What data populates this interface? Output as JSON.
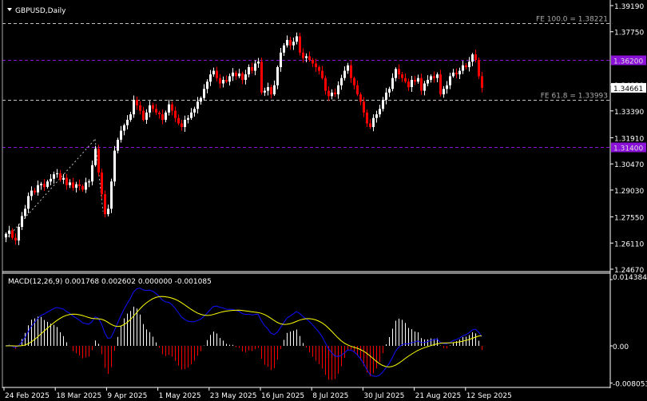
{
  "header": {
    "title": "GBPUSD,Daily",
    "menu_icon": "triangle-down-icon"
  },
  "colors": {
    "bull": "#ffffff",
    "bear": "#ff0000",
    "level": "#8b10d8",
    "fibo": "#c0c0c0",
    "macd": "#1010ff",
    "signal": "#ffff00",
    "background": "#000000"
  },
  "chart_data": [
    {
      "type": "candlestick",
      "symbol": "GBPUSD",
      "timeframe": "Daily",
      "ylim": [
        1.2467,
        1.3919
      ],
      "y_ticks": [
        "1.39190",
        "1.37750",
        "1.34830",
        "1.33390",
        "1.31910",
        "1.30470",
        "1.29030",
        "1.27550",
        "1.26110",
        "1.24670"
      ],
      "x_ticks": [
        "24 Feb 2025",
        "18 Mar 2025",
        "9 Apr 2025",
        "1 May 2025",
        "23 May 2025",
        "16 Jun 2025",
        "8 Jul 2025",
        "30 Jul 2025",
        "21 Aug 2025",
        "12 Sep 2025"
      ],
      "closes": [
        1.2662,
        1.268,
        1.264,
        1.2625,
        1.27,
        1.276,
        1.28,
        1.287,
        1.29,
        1.289,
        1.293,
        1.2937,
        1.292,
        1.295,
        1.2965,
        1.299,
        1.2995,
        1.296,
        1.297,
        1.293,
        1.2945,
        1.2915,
        1.2935,
        1.2925,
        1.2905,
        1.2945,
        1.295,
        1.304,
        1.313,
        1.3,
        1.288,
        1.277,
        1.28,
        1.295,
        1.312,
        1.318,
        1.323,
        1.326,
        1.329,
        1.332,
        1.34,
        1.337,
        1.334,
        1.329,
        1.333,
        1.337,
        1.335,
        1.333,
        1.332,
        1.329,
        1.333,
        1.3375,
        1.334,
        1.33,
        1.327,
        1.325,
        1.329,
        1.33,
        1.333,
        1.335,
        1.339,
        1.341,
        1.346,
        1.35,
        1.354,
        1.356,
        1.352,
        1.349,
        1.351,
        1.35,
        1.353,
        1.355,
        1.353,
        1.3545,
        1.351,
        1.354,
        1.358,
        1.356,
        1.36,
        1.361,
        1.344,
        1.345,
        1.347,
        1.343,
        1.348,
        1.358,
        1.366,
        1.37,
        1.373,
        1.37,
        1.372,
        1.375,
        1.366,
        1.363,
        1.364,
        1.362,
        1.36,
        1.358,
        1.356,
        1.352,
        1.345,
        1.342,
        1.344,
        1.343,
        1.348,
        1.352,
        1.356,
        1.359,
        1.352,
        1.348,
        1.343,
        1.339,
        1.333,
        1.327,
        1.325,
        1.33,
        1.332,
        1.335,
        1.34,
        1.344,
        1.346,
        1.352,
        1.357,
        1.354,
        1.352,
        1.35,
        1.347,
        1.351,
        1.35,
        1.352,
        1.345,
        1.349,
        1.351,
        1.353,
        1.352,
        1.354,
        1.343,
        1.346,
        1.348,
        1.353,
        1.355,
        1.354,
        1.356,
        1.359,
        1.358,
        1.361,
        1.365,
        1.362,
        1.353,
        1.34661
      ],
      "current_price": "1.34661",
      "levels": [
        {
          "price": 1.38221,
          "label": "FE 100.0 = 1.38221",
          "kind": "fibo"
        },
        {
          "price": 1.362,
          "tag": "1.36200",
          "kind": "level"
        },
        {
          "price": 1.33993,
          "label": "FE 61.8 = 1.33993",
          "kind": "fibo"
        },
        {
          "price": 1.314,
          "tag": "1.31400",
          "kind": "level"
        }
      ]
    },
    {
      "type": "macd",
      "title": "MACD(12,26,9) 0.001768 0.002602 0.000000 -0.001085",
      "params": [
        12,
        26,
        9
      ],
      "ylim": [
        -0.008053,
        0.014384
      ],
      "y_ticks": [
        "0.014384",
        "0.00",
        "-0.008053"
      ]
    }
  ]
}
